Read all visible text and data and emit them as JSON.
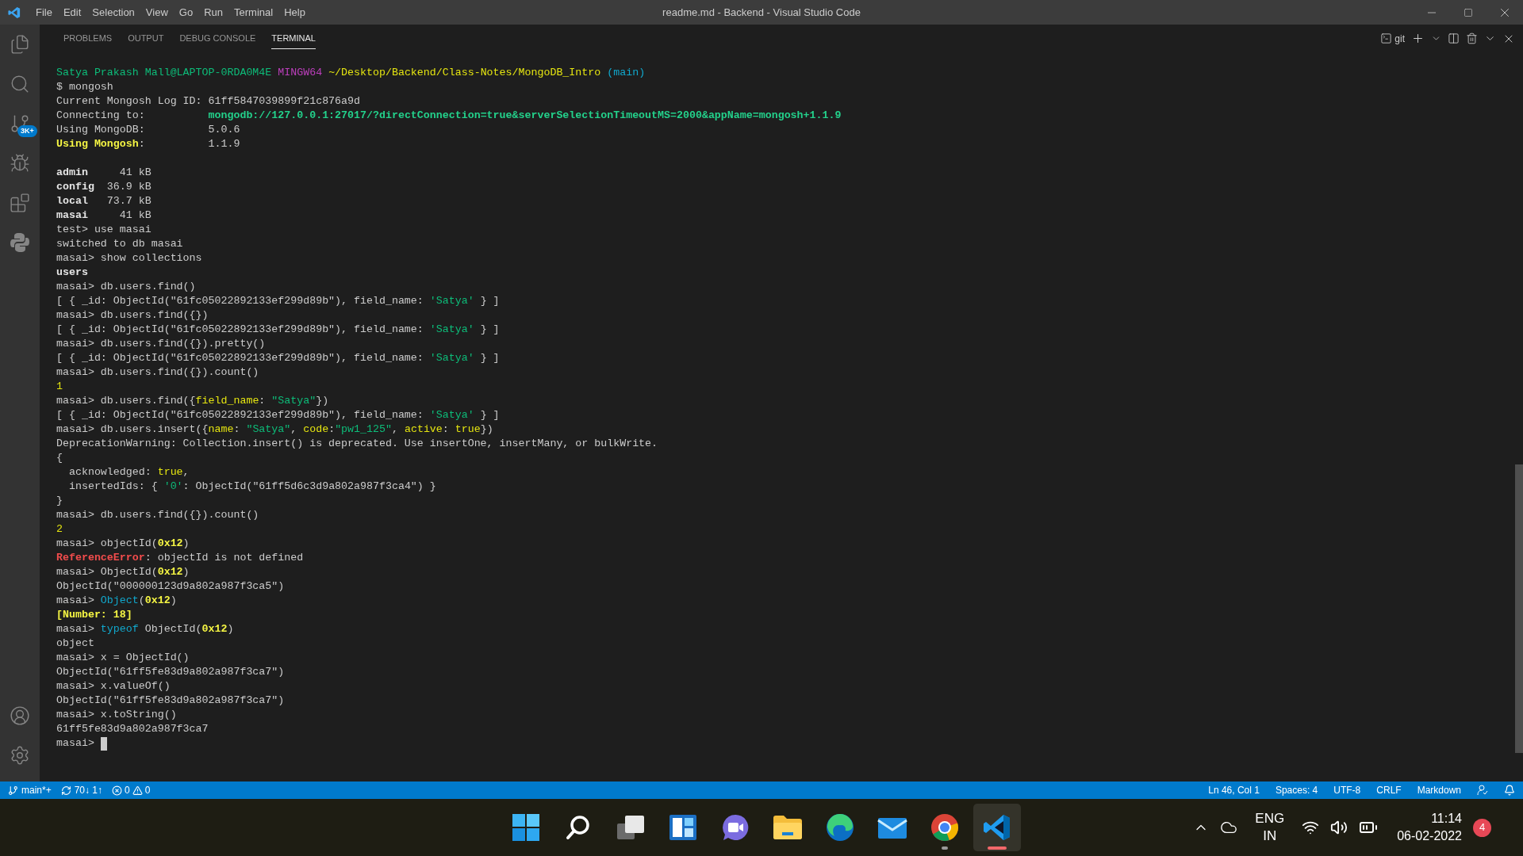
{
  "window": {
    "title": "readme.md - Backend - Visual Studio Code"
  },
  "menu": [
    "File",
    "Edit",
    "Selection",
    "View",
    "Go",
    "Run",
    "Terminal",
    "Help"
  ],
  "activity_bar": {
    "source_control_badge": "3K+"
  },
  "panel_tabs": [
    {
      "label": "PROBLEMS",
      "selected": false
    },
    {
      "label": "OUTPUT",
      "selected": false
    },
    {
      "label": "DEBUG CONSOLE",
      "selected": false
    },
    {
      "label": "TERMINAL",
      "selected": true
    }
  ],
  "terminal_toolbar": {
    "shell": "git"
  },
  "terminal": {
    "lines": [
      {
        "segments": [
          {
            "kind": "green",
            "text": "Satya Prakash Mall@LAPTOP-0RDA0M4E"
          },
          {
            "kind": "magenta",
            "text": " MINGW64"
          },
          {
            "kind": "yellow",
            "text": " ~/Desktop/Backend/Class-Notes/MongoDB_Intro"
          },
          {
            "kind": "cyan",
            "text": " (main)"
          }
        ]
      },
      {
        "segments": [
          {
            "kind": "plain",
            "text": "$ mongosh"
          }
        ]
      },
      {
        "segments": [
          {
            "kind": "plain",
            "text": "Current Mongosh Log ID: 61ff5847039899f21c876a9d"
          }
        ]
      },
      {
        "segments": [
          {
            "kind": "plain",
            "text": "Connecting to:          "
          },
          {
            "kind": "green-bold",
            "text": "mongodb://127.0.0.1:27017/?directConnection=true&serverSelectionTimeoutMS=2000&appName=mongosh+1.1.9"
          }
        ]
      },
      {
        "segments": [
          {
            "kind": "plain",
            "text": "Using MongoDB:          5.0.6"
          }
        ]
      },
      {
        "segments": [
          {
            "kind": "yellow-bold",
            "text": "Using Mongosh"
          },
          {
            "kind": "plain",
            "text": ":          1.1.9"
          }
        ]
      },
      {
        "gap_before": true,
        "segments": [
          {
            "kind": "bold",
            "text": "admin"
          },
          {
            "kind": "plain",
            "text": "     41 kB"
          }
        ]
      },
      {
        "segments": [
          {
            "kind": "bold",
            "text": "config"
          },
          {
            "kind": "plain",
            "text": "  36.9 kB"
          }
        ]
      },
      {
        "segments": [
          {
            "kind": "bold",
            "text": "local"
          },
          {
            "kind": "plain",
            "text": "   73.7 kB"
          }
        ]
      },
      {
        "segments": [
          {
            "kind": "bold",
            "text": "masai"
          },
          {
            "kind": "plain",
            "text": "     41 kB"
          }
        ]
      },
      {
        "segments": [
          {
            "kind": "plain",
            "text": "test> use masai"
          }
        ]
      },
      {
        "segments": [
          {
            "kind": "plain",
            "text": "switched to db masai"
          }
        ]
      },
      {
        "segments": [
          {
            "kind": "plain",
            "text": "masai> show collections"
          }
        ]
      },
      {
        "segments": [
          {
            "kind": "bold",
            "text": "users"
          }
        ]
      },
      {
        "segments": [
          {
            "kind": "plain",
            "text": "masai> db.users.find()"
          }
        ]
      },
      {
        "segments": [
          {
            "kind": "plain",
            "text": "[ { _id: ObjectId(\"61fc05022892133ef299d89b\"), field_name: "
          },
          {
            "kind": "green",
            "text": "'Satya'"
          },
          {
            "kind": "plain",
            "text": " } ]"
          }
        ]
      },
      {
        "segments": [
          {
            "kind": "plain",
            "text": "masai> db.users.find({})"
          }
        ]
      },
      {
        "segments": [
          {
            "kind": "plain",
            "text": "[ { _id: ObjectId(\"61fc05022892133ef299d89b\"), field_name: "
          },
          {
            "kind": "green",
            "text": "'Satya'"
          },
          {
            "kind": "plain",
            "text": " } ]"
          }
        ]
      },
      {
        "segments": [
          {
            "kind": "plain",
            "text": "masai> db.users.find({}).pretty()"
          }
        ]
      },
      {
        "segments": [
          {
            "kind": "plain",
            "text": "[ { _id: ObjectId(\"61fc05022892133ef299d89b\"), field_name: "
          },
          {
            "kind": "green",
            "text": "'Satya'"
          },
          {
            "kind": "plain",
            "text": " } ]"
          }
        ]
      },
      {
        "segments": [
          {
            "kind": "plain",
            "text": "masai> db.users.find({}).count()"
          }
        ]
      },
      {
        "segments": [
          {
            "kind": "yellow",
            "text": "1"
          }
        ]
      },
      {
        "segments": [
          {
            "kind": "plain",
            "text": "masai> db.users.find({"
          },
          {
            "kind": "yellow",
            "text": "field_name"
          },
          {
            "kind": "plain",
            "text": ": "
          },
          {
            "kind": "green",
            "text": "\"Satya\""
          },
          {
            "kind": "plain",
            "text": "})"
          }
        ]
      },
      {
        "segments": [
          {
            "kind": "plain",
            "text": "[ { _id: ObjectId(\"61fc05022892133ef299d89b\"), field_name: "
          },
          {
            "kind": "green",
            "text": "'Satya'"
          },
          {
            "kind": "plain",
            "text": " } ]"
          }
        ]
      },
      {
        "segments": [
          {
            "kind": "plain",
            "text": "masai> db.users.insert({"
          },
          {
            "kind": "yellow",
            "text": "name"
          },
          {
            "kind": "plain",
            "text": ": "
          },
          {
            "kind": "green",
            "text": "\"Satya\""
          },
          {
            "kind": "plain",
            "text": ", "
          },
          {
            "kind": "yellow",
            "text": "code"
          },
          {
            "kind": "plain",
            "text": ":"
          },
          {
            "kind": "green",
            "text": "\"pw1_125\""
          },
          {
            "kind": "plain",
            "text": ", "
          },
          {
            "kind": "yellow",
            "text": "active"
          },
          {
            "kind": "plain",
            "text": ": "
          },
          {
            "kind": "yellow",
            "text": "true"
          },
          {
            "kind": "plain",
            "text": "})"
          }
        ]
      },
      {
        "segments": [
          {
            "kind": "plain",
            "text": "DeprecationWarning: Collection.insert() is deprecated. Use insertOne, insertMany, or bulkWrite."
          }
        ]
      },
      {
        "segments": [
          {
            "kind": "plain",
            "text": "{"
          }
        ]
      },
      {
        "segments": [
          {
            "kind": "plain",
            "text": "  acknowledged: "
          },
          {
            "kind": "yellow",
            "text": "true"
          },
          {
            "kind": "plain",
            "text": ","
          }
        ]
      },
      {
        "segments": [
          {
            "kind": "plain",
            "text": "  insertedIds: { "
          },
          {
            "kind": "green",
            "text": "'0'"
          },
          {
            "kind": "plain",
            "text": ": ObjectId(\"61ff5d6c3d9a802a987f3ca4\") }"
          }
        ]
      },
      {
        "segments": [
          {
            "kind": "plain",
            "text": "}"
          }
        ]
      },
      {
        "segments": [
          {
            "kind": "plain",
            "text": "masai> db.users.find({}).count()"
          }
        ]
      },
      {
        "segments": [
          {
            "kind": "yellow",
            "text": "2"
          }
        ]
      },
      {
        "segments": [
          {
            "kind": "plain",
            "text": "masai> objectId("
          },
          {
            "kind": "yellow-bold",
            "text": "0x12"
          },
          {
            "kind": "plain",
            "text": ")"
          }
        ]
      },
      {
        "segments": [
          {
            "kind": "red-bold",
            "text": "ReferenceError"
          },
          {
            "kind": "plain",
            "text": ": objectId is not defined"
          }
        ]
      },
      {
        "segments": [
          {
            "kind": "plain",
            "text": "masai> ObjectId("
          },
          {
            "kind": "yellow-bold",
            "text": "0x12"
          },
          {
            "kind": "plain",
            "text": ")"
          }
        ]
      },
      {
        "segments": [
          {
            "kind": "plain",
            "text": "ObjectId(\"000000123d9a802a987f3ca5\")"
          }
        ]
      },
      {
        "segments": [
          {
            "kind": "plain",
            "text": "masai> "
          },
          {
            "kind": "cyan",
            "text": "Object"
          },
          {
            "kind": "plain",
            "text": "("
          },
          {
            "kind": "yellow-bold",
            "text": "0x12"
          },
          {
            "kind": "plain",
            "text": ")"
          }
        ]
      },
      {
        "segments": [
          {
            "kind": "yellow-bold",
            "text": "[Number: 18]"
          }
        ]
      },
      {
        "segments": [
          {
            "kind": "plain",
            "text": "masai> "
          },
          {
            "kind": "cyan",
            "text": "typeof"
          },
          {
            "kind": "plain",
            "text": " ObjectId("
          },
          {
            "kind": "yellow-bold",
            "text": "0x12"
          },
          {
            "kind": "plain",
            "text": ")"
          }
        ]
      },
      {
        "segments": [
          {
            "kind": "plain",
            "text": "object"
          }
        ]
      },
      {
        "segments": [
          {
            "kind": "plain",
            "text": "masai> x = ObjectId()"
          }
        ]
      },
      {
        "segments": [
          {
            "kind": "plain",
            "text": "ObjectId(\"61ff5fe83d9a802a987f3ca7\")"
          }
        ]
      },
      {
        "segments": [
          {
            "kind": "plain",
            "text": "masai> x.valueOf()"
          }
        ]
      },
      {
        "segments": [
          {
            "kind": "plain",
            "text": "ObjectId(\"61ff5fe83d9a802a987f3ca7\")"
          }
        ]
      },
      {
        "segments": [
          {
            "kind": "plain",
            "text": "masai> x.toString()"
          }
        ]
      },
      {
        "segments": [
          {
            "kind": "plain",
            "text": "61ff5fe83d9a802a987f3ca7"
          }
        ]
      },
      {
        "cursor": true,
        "segments": [
          {
            "kind": "plain",
            "text": "masai>"
          }
        ]
      }
    ]
  },
  "status_bar": {
    "branch": "main*+",
    "sync": "70↓ 1↑",
    "errors": "0",
    "warnings": "0",
    "right": [
      "Ln 46, Col 1",
      "Spaces: 4",
      "UTF-8",
      "CRLF",
      "Markdown"
    ]
  },
  "taskbar": {
    "apps": [
      {
        "kind": "start",
        "running": false,
        "selected": false
      },
      {
        "kind": "search",
        "running": false,
        "selected": false
      },
      {
        "kind": "task-view",
        "running": false,
        "selected": false
      },
      {
        "kind": "widgets",
        "running": false,
        "selected": false
      },
      {
        "kind": "chat",
        "running": false,
        "selected": false
      },
      {
        "kind": "folder",
        "running": false,
        "selected": false
      },
      {
        "kind": "browser-wave",
        "running": false,
        "selected": false
      },
      {
        "kind": "mail",
        "running": false,
        "selected": false
      },
      {
        "kind": "browser-circle",
        "running": true,
        "selected": false
      },
      {
        "kind": "code-editor",
        "running": true,
        "selected": true
      }
    ],
    "language": "ENG",
    "region": "IN",
    "time": "11:14",
    "date": "06-02-2022",
    "notifications": "4"
  }
}
